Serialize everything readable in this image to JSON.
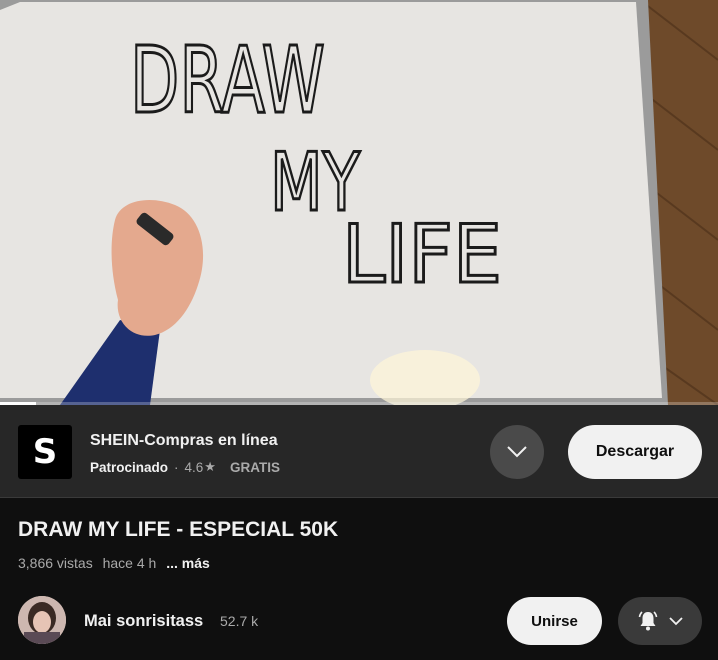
{
  "video": {
    "board_text": [
      "DRAW",
      "MY",
      "LIFE"
    ],
    "progress_fraction": 0.05
  },
  "ad": {
    "logo_letter": "S",
    "title": "SHEIN-Compras en línea",
    "sponsored": "Patrocinado",
    "separator": "·",
    "rating": "4.6",
    "star": "★",
    "price": "GRATIS",
    "expand_icon": "chevron-down-icon",
    "download_label": "Descargar"
  },
  "info": {
    "title": "DRAW MY LIFE - ESPECIAL 50K",
    "views": "3,866 vistas",
    "age": "hace 4 h",
    "more": "... más"
  },
  "channel": {
    "name": "Mai sonrisitass",
    "subscribers": "52.7 k",
    "join_label": "Unirse",
    "bell_icon": "bell-ringing-icon",
    "dropdown_icon": "chevron-down-icon"
  },
  "colors": {
    "background": "#0f0f0f",
    "ad_background": "#272727",
    "button_light": "#f1f1f1",
    "secondary_text": "#aaaaaa"
  }
}
